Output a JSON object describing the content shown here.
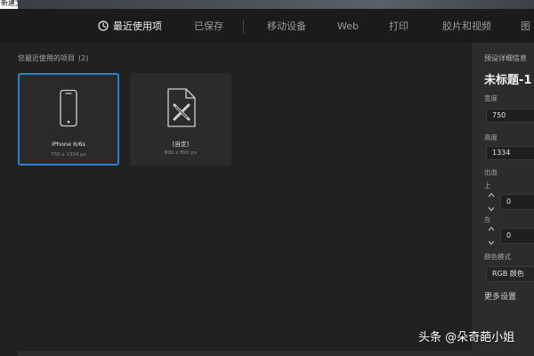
{
  "window": {
    "title": "新建文档"
  },
  "nav": {
    "tabs": [
      {
        "label": "最近使用项",
        "active": true
      },
      {
        "label": "已保存",
        "active": false
      },
      {
        "label": "移动设备",
        "active": false
      },
      {
        "label": "Web",
        "active": false
      },
      {
        "label": "打印",
        "active": false
      },
      {
        "label": "胶片和视频",
        "active": false
      },
      {
        "label": "图",
        "active": false
      }
    ],
    "active_icon": "clock-icon"
  },
  "recent": {
    "label": "您最近使用的项目",
    "count": "(2)",
    "items": [
      {
        "name": "iPhone 6/6s",
        "size": "750 x 1334 px",
        "icon": "phone-icon",
        "selected": true
      },
      {
        "name": "[自定]",
        "size": "800 x 800 px",
        "icon": "custom-doc-icon",
        "selected": false
      }
    ]
  },
  "details": {
    "header": "预设详细信息",
    "doc_title": "未标题-1",
    "width_label": "宽度",
    "width_value": "750",
    "height_label": "高度",
    "height_value": "1334",
    "bleed_label": "出血",
    "top_label": "上",
    "top_value": "0",
    "left_label": "左",
    "left_value": "0",
    "color_mode_label": "颜色模式",
    "color_mode_value": "RGB 颜色",
    "more_settings": "更多设置"
  },
  "watermark": "头条 @朵奇葩小姐",
  "colors": {
    "accent": "#2d7fd3",
    "background": "#212121",
    "panel": "#2c2c2c"
  }
}
